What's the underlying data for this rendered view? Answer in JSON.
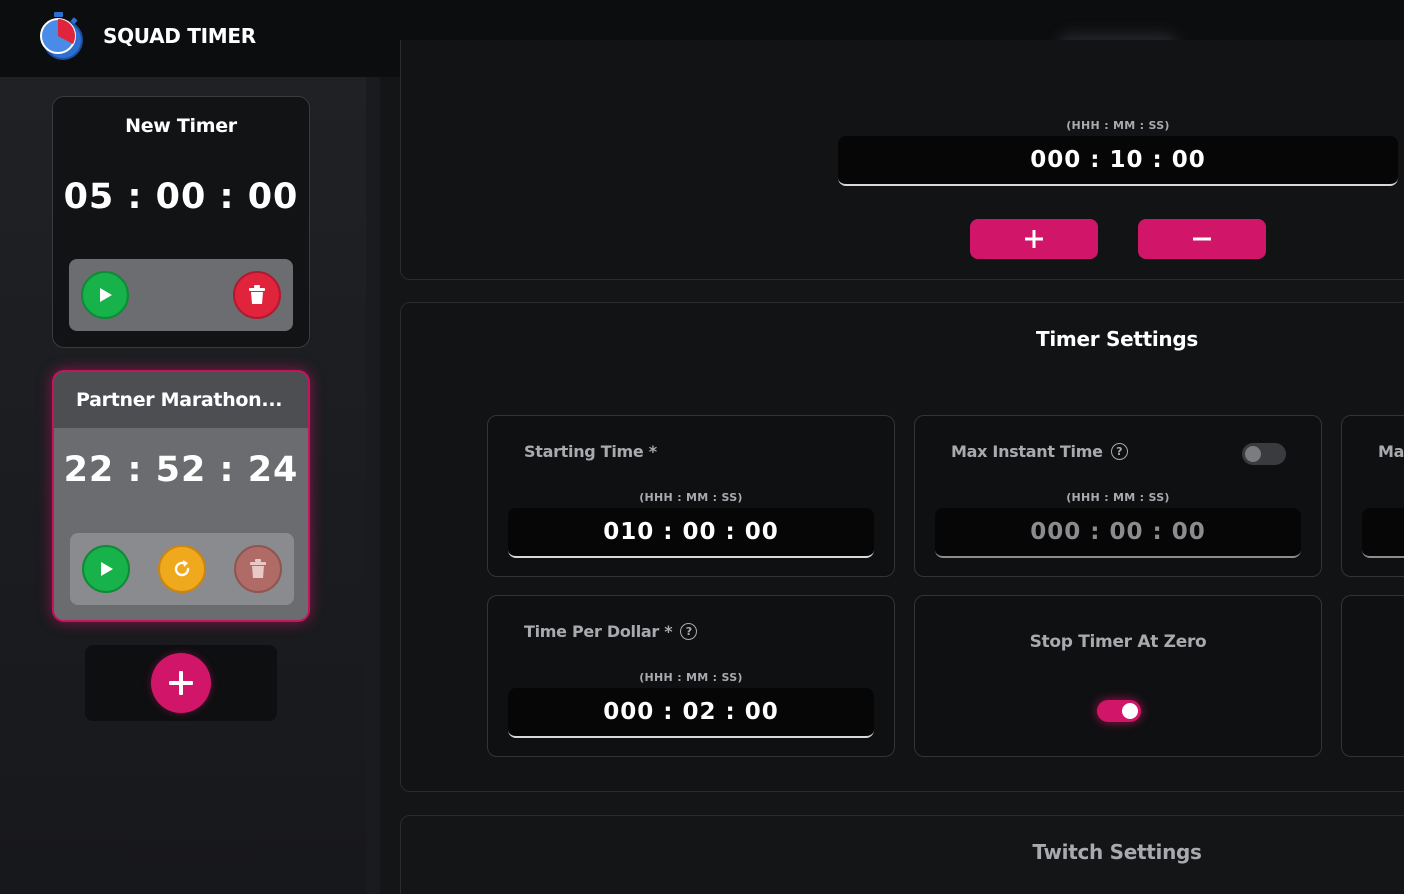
{
  "app": {
    "brand": "SQUAD TIMER"
  },
  "icons": {
    "logo": "stopwatch-logo-icon",
    "play": "play-icon",
    "delete": "trash-icon",
    "reset": "refresh-icon",
    "add": "plus-icon",
    "help": "help-icon"
  },
  "colors": {
    "accent": "#d1166a",
    "play": "#17b24a",
    "delete": "#e0243c",
    "reset": "#f0a81c"
  },
  "sidebar": {
    "timers": [
      {
        "title": "New Timer",
        "time": "05 : 00 : 00",
        "selected": false
      },
      {
        "title": "Partner Marathon...",
        "time": "22 : 52 : 24",
        "selected": true
      }
    ]
  },
  "main": {
    "adjust": {
      "format": "(HHH : MM : SS)",
      "value": "000 : 10 : 00",
      "plus_label": "+",
      "minus_label": "−"
    },
    "timer_settings": {
      "title": "Timer Settings",
      "starting_time": {
        "label": "Starting Time *",
        "format": "(HHH : MM : SS)",
        "value": "010 : 00 : 00"
      },
      "max_instant_time": {
        "label": "Max Instant Time",
        "format": "(HHH : MM : SS)",
        "value": "000 : 00 : 00",
        "enabled": false
      },
      "third_card_label": "Max",
      "time_per_dollar": {
        "label": "Time Per Dollar *",
        "format": "(HHH : MM : SS)",
        "value": "000 : 02 : 00"
      },
      "stop_timer_at_zero": {
        "label": "Stop Timer At Zero",
        "enabled": true
      }
    },
    "twitch_settings": {
      "title": "Twitch Settings"
    }
  }
}
